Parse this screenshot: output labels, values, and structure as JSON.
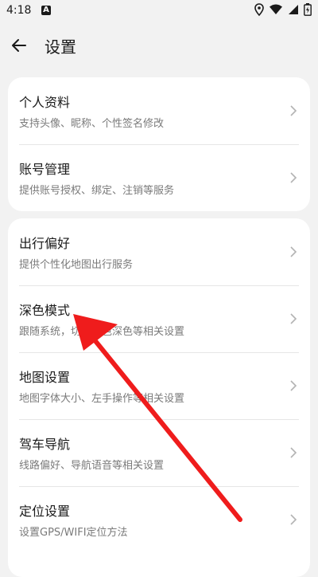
{
  "status_bar": {
    "time": "4:18",
    "notification_glyph": "A",
    "icons": [
      "location-icon",
      "wifi-icon",
      "signal-icon",
      "battery-icon"
    ]
  },
  "header": {
    "back_icon": "back-arrow-icon",
    "title": "设置"
  },
  "groups": [
    {
      "items": [
        {
          "title": "个人资料",
          "subtitle": "支持头像、昵称、个性签名修改"
        },
        {
          "title": "账号管理",
          "subtitle": "提供账号授权、绑定、注销等服务"
        }
      ]
    },
    {
      "items": [
        {
          "title": "出行偏好",
          "subtitle": "提供个性化地图出行服务"
        },
        {
          "title": "深色模式",
          "subtitle": "跟随系统，切换浅色深色等相关设置"
        },
        {
          "title": "地图设置",
          "subtitle": "地图字体大小、左手操作等相关设置"
        },
        {
          "title": "驾车导航",
          "subtitle": "线路偏好、导航语音等相关设置"
        },
        {
          "title": "定位设置",
          "subtitle": "设置GPS/WIFI定位方法"
        }
      ]
    }
  ],
  "annotation": {
    "icon": "red-arrow-icon",
    "color": "#ef1c1c",
    "points_to": "深色模式"
  },
  "colors": {
    "background": "#f2f2f2",
    "card": "#ffffff",
    "title_text": "#1a1a1a",
    "subtitle_text": "#7a7a7a",
    "chevron": "#b3b3b3"
  }
}
